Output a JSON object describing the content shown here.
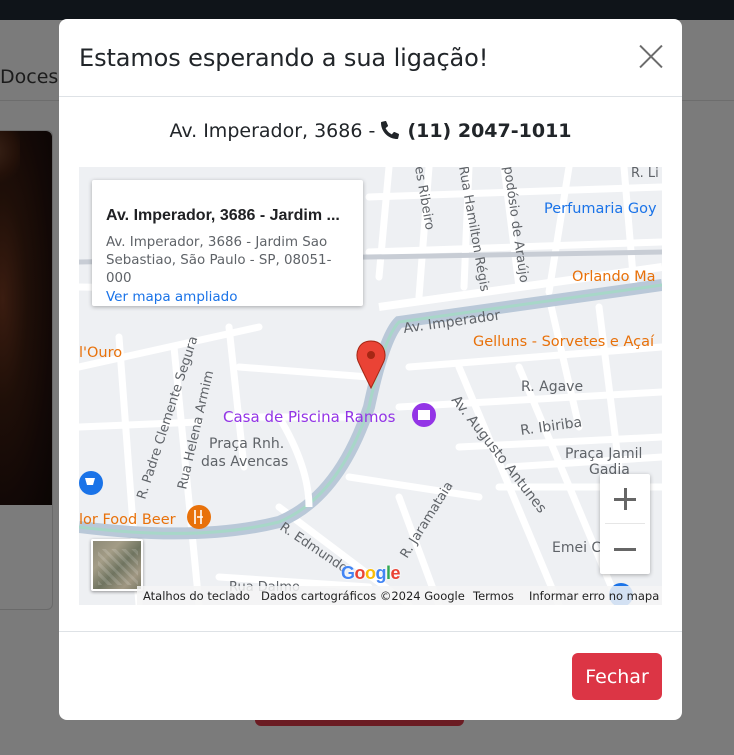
{
  "background": {
    "nav_label": "Doces"
  },
  "modal": {
    "title": "Estamos esperando a sua ligação!",
    "address": "Av. Imperador, 3686 -",
    "phone": "(11) 2047-1011",
    "close_button": "Fechar"
  },
  "map": {
    "info_title": "Av. Imperador, 3686 - Jardim ...",
    "info_address": "Av. Imperador, 3686 - Jardim Sao Sebastiao, São Paulo - SP, 08051-000",
    "info_link": "Ver mapa ampliado",
    "labels": {
      "perfumaria": "Perfumaria Goy",
      "orlando": "Orlando Ma",
      "av_imperador": "Av. Imperador",
      "gelluns": "Gelluns - Sorvetes e Açaí",
      "ouro": "l'Ouro",
      "r_agave": "R. Agave",
      "casa_piscina": "Casa de Piscina Ramos",
      "r_ibiriba": "R. Ibiriba",
      "av_augusto": "Av. Augusto Antunes",
      "praca_jamil_1": "Praça Jamil",
      "praca_jamil_2": "Gadia",
      "praca_rnh_1": "Praça Rnh.",
      "praca_rnh_2": "das Avencas",
      "r_padre": "R. Padre Clemente Segura",
      "rua_helena": "Rua Helena Armim",
      "food_beer": "lor Food Beer",
      "r_jaramataia": "R. Jaramataia",
      "r_edmundo": "R. Edmundo",
      "emei": "Emei C",
      "rua_dalmo": "Rua Dalmo",
      "es_ribeiro": "es Ribeiro",
      "hamilton": "Rua Hamilton Régis",
      "podosio": "podósio de Araújo",
      "r_li": "R. Li"
    },
    "google_logo": "Google",
    "attribution": {
      "shortcuts": "Atalhos do teclado",
      "data": "Dados cartográficos ©2024 Google",
      "terms": "Termos",
      "report": "Informar erro no mapa"
    },
    "colors": {
      "poi_purple": "#9334e6",
      "poi_orange": "#e8710a",
      "poi_blue": "#1a73e8",
      "pin_red": "#ea4335"
    }
  }
}
